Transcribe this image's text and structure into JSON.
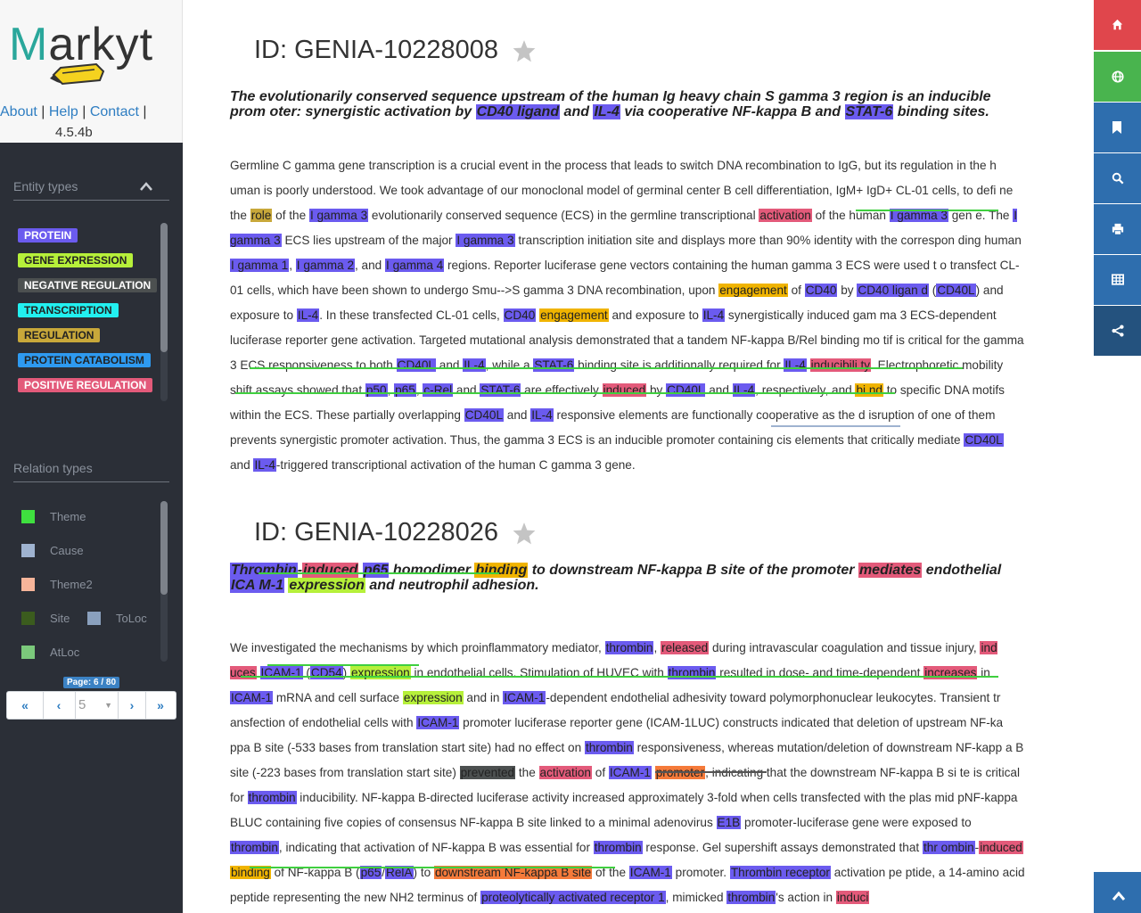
{
  "app": {
    "name": "Markyt",
    "links": {
      "about": "About",
      "help": "Help",
      "contact": "Contact"
    },
    "version": "4.5.4b"
  },
  "sidebar": {
    "entity_title": "Entity types",
    "entities": [
      {
        "label": "PROTEIN",
        "color": "#6b5bef",
        "text": "#ffffff"
      },
      {
        "label": "GENE EXPRESSION",
        "color": "#b6f03a",
        "text": "#222222"
      },
      {
        "label": "NEGATIVE REGULATION",
        "color": "#4c5050",
        "text": "#ffffff"
      },
      {
        "label": "TRANSCRIPTION",
        "color": "#22f0f0",
        "text": "#222222"
      },
      {
        "label": "REGULATION",
        "color": "#c8a83a",
        "text": "#222222"
      },
      {
        "label": "PROTEIN CATABOLISM",
        "color": "#2e9af0",
        "text": "#222222"
      },
      {
        "label": "POSITIVE REGULATION",
        "color": "#e35a7a",
        "text": "#ffffff"
      }
    ],
    "relation_title": "Relation types",
    "relations": [
      {
        "label": "Theme",
        "color": "#3fe03f"
      },
      {
        "label": "Cause",
        "color": "#9fb3d0"
      },
      {
        "label": "Theme2",
        "color": "#f7b59a"
      },
      {
        "label": "Site",
        "color": "#3b5c1e"
      },
      {
        "label": "ToLoc",
        "color": "#8aa0bd"
      },
      {
        "label": "AtLoc",
        "color": "#7bc97b"
      }
    ],
    "pagination": {
      "first": "«",
      "prev": "‹",
      "current": "5",
      "next": "›",
      "last": "»",
      "page_badge": "Page: 6 / 80"
    }
  },
  "toolbar": [
    {
      "name": "home-icon",
      "color": "#e0464c"
    },
    {
      "name": "globe-icon",
      "color": "#49b44e"
    },
    {
      "name": "bookmark-icon",
      "color": "#2e6eae"
    },
    {
      "name": "search-icon",
      "color": "#2e6eae"
    },
    {
      "name": "print-icon",
      "color": "#2e6eae"
    },
    {
      "name": "table-icon",
      "color": "#2e6eae"
    },
    {
      "name": "share-icon",
      "color": "#24527e"
    },
    {
      "name": "scroll-top-icon",
      "color": "#2e6eae"
    }
  ],
  "documents": [
    {
      "id": "ID: GENIA-10228008",
      "title_parts": [
        {
          "t": "The evolutionarily conserved sequence upstream of the human Ig heavy chain S gamma 3 region is an inducible prom oter: synergistic activation by "
        },
        {
          "t": "CD40 ligand",
          "c": "p"
        },
        {
          "t": " and "
        },
        {
          "t": "IL-4",
          "c": "p"
        },
        {
          "t": " via cooperative NF-kappa B and "
        },
        {
          "t": "STAT-6",
          "c": "p"
        },
        {
          "t": " binding sites."
        }
      ],
      "para_parts": [
        {
          "t": "Germline C gamma gene transcription is a crucial event in the process that leads to switch DNA recombination to IgG, but its regulation in the h uman is poorly understood. We took advantage of our monoclonal model of germinal center B cell differentiation, IgM+ IgD+ CL-01 cells, to defi ne the "
        },
        {
          "t": "role",
          "c": "reg"
        },
        {
          "t": " of the "
        },
        {
          "t": "I gamma 3",
          "c": "p"
        },
        {
          "t": " evolutionarily conserved sequence (ECS) in the germline transcriptional "
        },
        {
          "t": "activation",
          "c": "pos"
        },
        {
          "t": " of the human "
        },
        {
          "t": "I gamma 3",
          "c": "p"
        },
        {
          "t": " gen e. The "
        },
        {
          "t": "I gamma 3",
          "c": "p"
        },
        {
          "t": " ECS lies upstream of the major "
        },
        {
          "t": "I gamma 3",
          "c": "p"
        },
        {
          "t": " transcription initiation site and displays more than 90% identity with the correspon ding human "
        },
        {
          "t": "I gamma 1",
          "c": "p"
        },
        {
          "t": ", "
        },
        {
          "t": "I gamma 2",
          "c": "p"
        },
        {
          "t": ", and "
        },
        {
          "t": "I gamma 4",
          "c": "p"
        },
        {
          "t": " regions. Reporter luciferase gene vectors containing the human gamma 3 ECS were used t o transfect CL-01 cells, which have been shown to undergo Smu-->S gamma 3 DNA recombination, upon "
        },
        {
          "t": "engagement",
          "c": "bind"
        },
        {
          "t": " of "
        },
        {
          "t": "CD40",
          "c": "p"
        },
        {
          "t": " by "
        },
        {
          "t": "CD40 ligan d",
          "c": "p"
        },
        {
          "t": " ("
        },
        {
          "t": "CD40L",
          "c": "p"
        },
        {
          "t": ") and exposure to "
        },
        {
          "t": "IL-4",
          "c": "p"
        },
        {
          "t": ". In these transfected CL-01 cells, "
        },
        {
          "t": "CD40",
          "c": "p"
        },
        {
          "t": " "
        },
        {
          "t": "engagement",
          "c": "bind"
        },
        {
          "t": " and exposure to "
        },
        {
          "t": "IL-4",
          "c": "p"
        },
        {
          "t": " synergistically induced gam ma 3 ECS-dependent luciferase reporter gene activation. Targeted mutational analysis demonstrated that a tandem NF-kappa B/Rel binding mo tif is critical for the gamma 3 ECS responsiveness to both "
        },
        {
          "t": "CD40L",
          "c": "p"
        },
        {
          "t": " and "
        },
        {
          "t": "IL-4",
          "c": "p"
        },
        {
          "t": ", while a "
        },
        {
          "t": "STAT-6",
          "c": "p"
        },
        {
          "t": " binding site is additionally required for "
        },
        {
          "t": "IL-4",
          "c": "p"
        },
        {
          "t": " "
        },
        {
          "t": "inducibili ty",
          "c": "pos"
        },
        {
          "t": ". Electrophoretic mobility shift assays showed that "
        },
        {
          "t": "p50",
          "c": "p"
        },
        {
          "t": ", "
        },
        {
          "t": "p65",
          "c": "p"
        },
        {
          "t": ", "
        },
        {
          "t": "c-Rel",
          "c": "p"
        },
        {
          "t": " and "
        },
        {
          "t": "STAT-6",
          "c": "p"
        },
        {
          "t": " are effectively "
        },
        {
          "t": "induced",
          "c": "pos"
        },
        {
          "t": " by "
        },
        {
          "t": "CD40L",
          "c": "p"
        },
        {
          "t": " and "
        },
        {
          "t": "IL-4",
          "c": "p"
        },
        {
          "t": ", respectively, and "
        },
        {
          "t": "bi nd",
          "c": "bind"
        },
        {
          "t": " to specific DNA motifs within the ECS. These partially overlapping "
        },
        {
          "t": "CD40L",
          "c": "p"
        },
        {
          "t": " and "
        },
        {
          "t": "IL-4",
          "c": "p"
        },
        {
          "t": " responsive elements are functionally cooperative as the d isruption of one of them prevents synergistic promoter activation. Thus, the gamma 3 ECS is an inducible promoter containing cis elements that critically mediate "
        },
        {
          "t": "CD40L",
          "c": "p"
        },
        {
          "t": " and "
        },
        {
          "t": "IL-4",
          "c": "p"
        },
        {
          "t": "-triggered transcriptional activation of the human C gamma 3 gene."
        }
      ]
    },
    {
      "id": "ID: GENIA-10228026",
      "title_parts": [
        {
          "t": "Thrombin",
          "c": "p"
        },
        {
          "t": "-"
        },
        {
          "t": "induced",
          "c": "pos"
        },
        {
          "t": " "
        },
        {
          "t": "p65",
          "c": "p"
        },
        {
          "t": " homodimer "
        },
        {
          "t": "binding",
          "c": "bind"
        },
        {
          "t": " to downstream NF-kappa B site of the promoter "
        },
        {
          "t": "mediates",
          "c": "pos"
        },
        {
          "t": " endothelial "
        },
        {
          "t": "ICA M-1",
          "c": "p"
        },
        {
          "t": " "
        },
        {
          "t": "expression",
          "c": "ge"
        },
        {
          "t": " and neutrophil adhesion."
        }
      ],
      "para_parts": [
        {
          "t": "We investigated the mechanisms by which proinflammatory mediator, "
        },
        {
          "t": "thrombin",
          "c": "p"
        },
        {
          "t": ", "
        },
        {
          "t": "released",
          "c": "pos"
        },
        {
          "t": " during intravascular coagulation and tissue injury, "
        },
        {
          "t": "ind uces",
          "c": "pos"
        },
        {
          "t": " "
        },
        {
          "t": "ICAM-1",
          "c": "p"
        },
        {
          "t": " ("
        },
        {
          "t": "CD54",
          "c": "p"
        },
        {
          "t": ") "
        },
        {
          "t": "expression",
          "c": "ge"
        },
        {
          "t": " in endothelial cells. Stimulation of HUVEC with "
        },
        {
          "t": "thrombin",
          "c": "p"
        },
        {
          "t": " resulted in dose- and time-dependent "
        },
        {
          "t": "increases",
          "c": "pos"
        },
        {
          "t": " in "
        },
        {
          "t": "ICAM-1",
          "c": "p"
        },
        {
          "t": " mRNA and cell surface "
        },
        {
          "t": "expression",
          "c": "ge"
        },
        {
          "t": " and in "
        },
        {
          "t": "ICAM-1",
          "c": "p"
        },
        {
          "t": "-dependent endothelial adhesivity toward polymorphonuclear leukocytes. Transient tr ansfection of endothelial cells with "
        },
        {
          "t": "ICAM-1",
          "c": "p"
        },
        {
          "t": " promoter luciferase reporter gene (ICAM-1LUC) constructs indicated that deletion of upstream NF-ka ppa B site (-533 bases from translation start site) had no effect on "
        },
        {
          "t": "thrombin",
          "c": "p"
        },
        {
          "t": " responsiveness, whereas mutation/deletion of downstream NF-kapp a B site (-223 bases from translation start site) "
        },
        {
          "t": "prevented",
          "c": "neg"
        },
        {
          "t": " the "
        },
        {
          "t": "activation",
          "c": "pos"
        },
        {
          "t": " of "
        },
        {
          "t": "ICAM-1",
          "c": "p"
        },
        {
          "t": " "
        },
        {
          "t": "promoter",
          "c": "site"
        },
        {
          "t": ", indicating that the downstream NF-kappa B si te is critical for "
        },
        {
          "t": "thrombin",
          "c": "p"
        },
        {
          "t": " inducibility. NF-kappa B-directed luciferase activity increased approximately 3-fold when cells transfected with the plas mid pNF-kappa BLUC containing five copies of consensus NF-kappa B site linked to a minimal adenovirus "
        },
        {
          "t": "E1B",
          "c": "p"
        },
        {
          "t": " promoter-luciferase gene were exposed to "
        },
        {
          "t": "thrombin",
          "c": "p"
        },
        {
          "t": ", indicating that activation of NF-kappa B was essential for "
        },
        {
          "t": "thrombin",
          "c": "p"
        },
        {
          "t": " response. Gel supershift assays demonstrated that "
        },
        {
          "t": "thr ombin",
          "c": "p"
        },
        {
          "t": "-"
        },
        {
          "t": "induced",
          "c": "pos"
        },
        {
          "t": " "
        },
        {
          "t": "binding",
          "c": "bind"
        },
        {
          "t": " of NF-kappa B ("
        },
        {
          "t": "p65",
          "c": "p"
        },
        {
          "t": "/"
        },
        {
          "t": "RelA",
          "c": "p"
        },
        {
          "t": ") to "
        },
        {
          "t": "downstream NF-kappa B site",
          "c": "site"
        },
        {
          "t": " of the "
        },
        {
          "t": "ICAM-1",
          "c": "p"
        },
        {
          "t": " promoter. "
        },
        {
          "t": "Thrombin receptor",
          "c": "p"
        },
        {
          "t": " activation pe ptide, a 14-amino acid peptide representing the new NH2 terminus of "
        },
        {
          "t": "proteolytically activated receptor 1",
          "c": "p"
        },
        {
          "t": ", mimicked "
        },
        {
          "t": "thrombin",
          "c": "p"
        },
        {
          "t": "'s action in "
        },
        {
          "t": "induci",
          "c": "pos"
        }
      ]
    }
  ]
}
